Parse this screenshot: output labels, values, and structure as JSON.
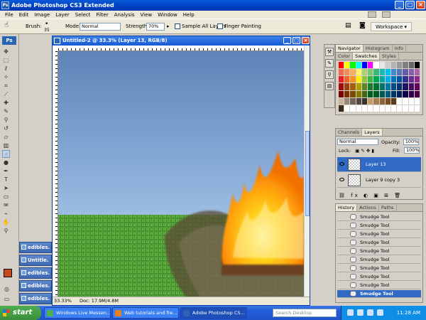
{
  "app": {
    "title": "Adobe Photoshop CS3 Extended",
    "logo": "Ps"
  },
  "menu": [
    "File",
    "Edit",
    "Image",
    "Layer",
    "Select",
    "Filter",
    "Analysis",
    "View",
    "Window",
    "Help"
  ],
  "options": {
    "brush_label": "Brush:",
    "brush_size": "35",
    "mode_label": "Mode:",
    "mode_value": "Normal",
    "strength_label": "Strength:",
    "strength_value": "70%",
    "sample_all_label": "Sample All Layers",
    "finger_label": "Finger Painting",
    "workspace_label": "Workspace ▾"
  },
  "doc_tasks": [
    "edibles.",
    "Untitle.",
    "edibles.",
    "edibles.",
    "edibles."
  ],
  "document": {
    "title": "Untitled-2 @ 33.3% (Layer 13, RGB/8)",
    "zoom": "33.33%",
    "doc_info": "Doc: 17.9M/4.8M"
  },
  "panels": {
    "navigator_tabs": [
      "Navigator",
      "Histogram",
      "Info"
    ],
    "swatch_tabs": [
      "Color",
      "Swatches",
      "Styles"
    ],
    "layers_tabs": [
      "Channels",
      "Layers"
    ],
    "blend_mode": "Normal",
    "opacity_label": "Opacity:",
    "opacity": "100%",
    "lock_label": "Lock:",
    "fill_label": "Fill:",
    "fill": "100%",
    "layers": [
      {
        "name": "Layer 13",
        "selected": true
      },
      {
        "name": "Layer 9 copy 3",
        "selected": false
      }
    ],
    "history_tabs": [
      "History",
      "Actions",
      "Paths"
    ],
    "history": [
      "Smudge Tool",
      "Smudge Tool",
      "Smudge Tool",
      "Smudge Tool",
      "Smudge Tool",
      "Smudge Tool",
      "Smudge Tool",
      "Smudge Tool",
      "Smudge Tool",
      "Smudge Tool"
    ]
  },
  "taskbar": {
    "start": "start",
    "tasks": [
      {
        "label": "Windows Live Messen...",
        "color": "#4fb04f"
      },
      {
        "label": "Web tutorials and fre...",
        "color": "#e67e22"
      },
      {
        "label": "Adobe Photoshop CS...",
        "color": "#2a65b4"
      }
    ],
    "search_placeholder": "Search Desktop",
    "clock": "11:28 AM"
  },
  "colors": {
    "foreground": "#c64a1c",
    "background": "#ffffff",
    "accent": "#316ac5"
  }
}
